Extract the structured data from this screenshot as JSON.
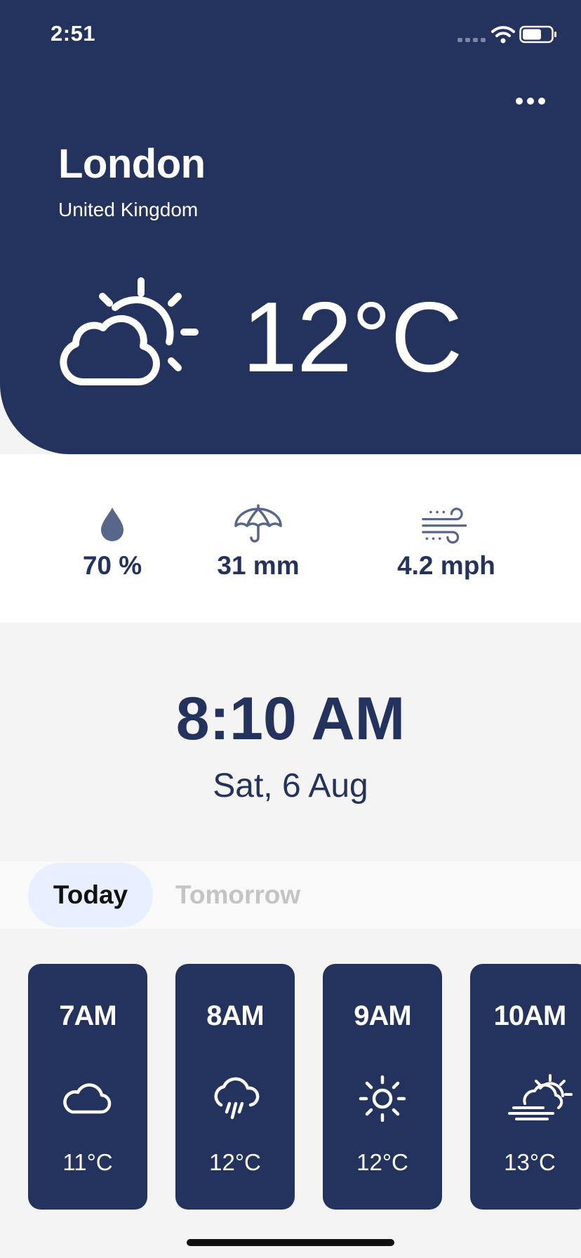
{
  "status_bar": {
    "time": "2:51",
    "signal_icon": "cellular-signal-icon",
    "wifi_icon": "wifi-icon",
    "battery_icon": "battery-icon"
  },
  "header": {
    "menu_icon": "more-horizontal-icon",
    "city": "London",
    "country": "United Kingdom",
    "weather_icon": "partly-cloudy-day-icon",
    "temperature": "12°C"
  },
  "stats": {
    "humidity": {
      "icon": "water-drop-icon",
      "value": "70 %"
    },
    "precipitation": {
      "icon": "umbrella-icon",
      "value": "31 mm"
    },
    "wind": {
      "icon": "wind-icon",
      "value": "4.2 mph"
    }
  },
  "clock": {
    "time": "8:10 AM",
    "date": "Sat, 6 Aug"
  },
  "tabs": [
    {
      "label": "Today",
      "active": true
    },
    {
      "label": "Tomorrow",
      "active": false
    }
  ],
  "hourly": [
    {
      "time": "7AM",
      "icon": "cloud-icon",
      "temp": "11°C"
    },
    {
      "time": "8AM",
      "icon": "rain-cloud-icon",
      "temp": "12°C"
    },
    {
      "time": "9AM",
      "icon": "sun-icon",
      "temp": "12°C"
    },
    {
      "time": "10AM",
      "icon": "partly-cloudy-fog-icon",
      "temp": "13°C"
    }
  ],
  "colors": {
    "primary": "#24335e",
    "background": "#f4f4f4",
    "tab_active_bg": "#e8efff",
    "tab_inactive_text": "#c4c4c4",
    "stat_icon": "#58668a"
  }
}
